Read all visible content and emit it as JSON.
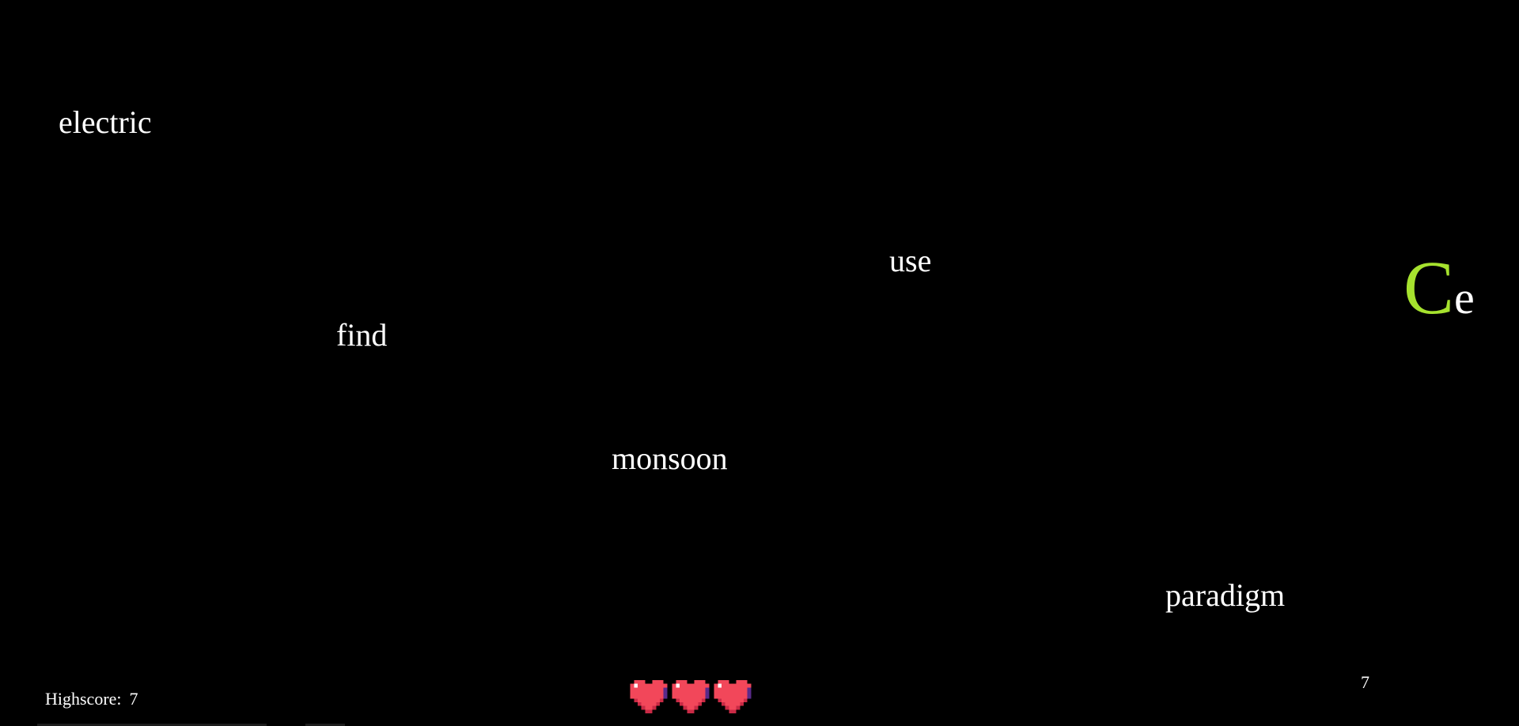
{
  "words": {
    "electric": "electric",
    "use": "use",
    "find": "find",
    "monsoon": "monsoon",
    "paradigm": "paradigm"
  },
  "active_word": {
    "typed": "C",
    "remaining": "e"
  },
  "hud": {
    "highscore_label": "Highscore:",
    "highscore_value": "7",
    "score_value": "7"
  },
  "lives": {
    "count": 3,
    "icon": "pixel-heart-icon"
  },
  "colors": {
    "background": "#000000",
    "text": "#ffffff",
    "typed_accent": "#a6e22e",
    "heart": "#f2475a"
  }
}
